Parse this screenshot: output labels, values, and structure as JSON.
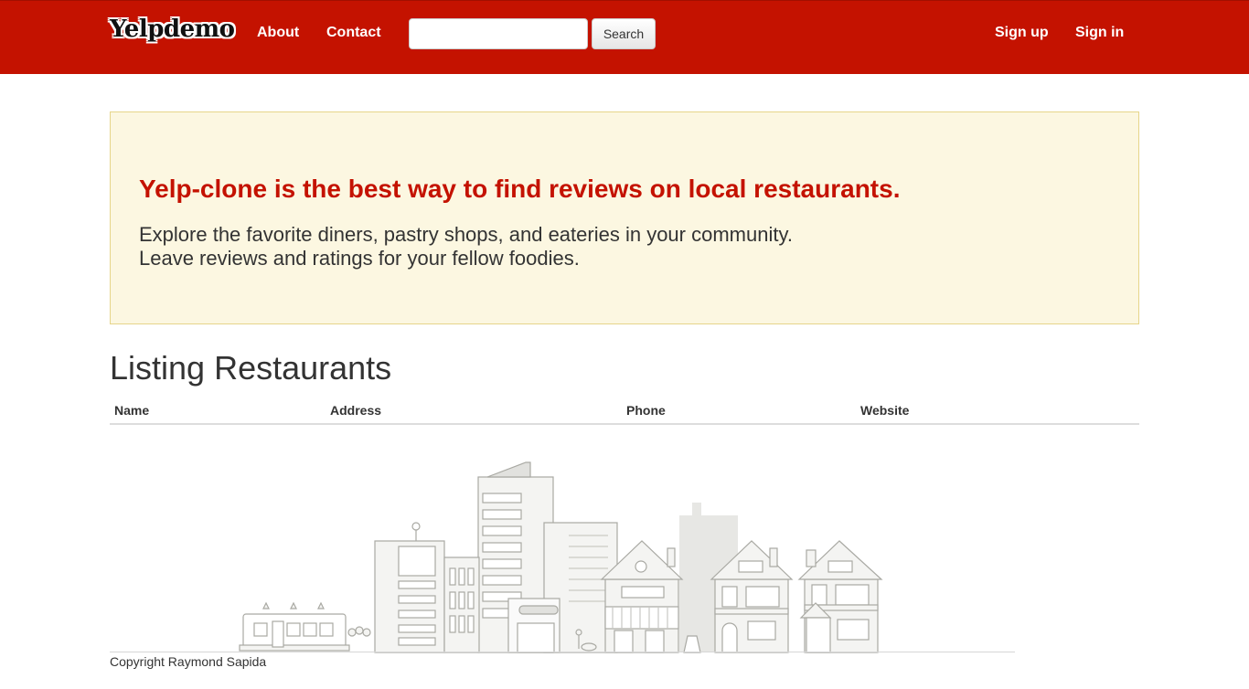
{
  "navbar": {
    "brand": "Yelpdemo",
    "links": {
      "about": "About",
      "contact": "Contact",
      "signup": "Sign up",
      "signin": "Sign in"
    },
    "search": {
      "value": "",
      "placeholder": "",
      "button": "Search"
    },
    "color": "#c41200"
  },
  "hero": {
    "title": "Yelp-clone is the best way to find reviews on local restaurants.",
    "line1": "Explore the favorite diners, pastry shops, and eateries in your community.",
    "line2": "Leave reviews and ratings for your fellow foodies."
  },
  "listing": {
    "title": "Listing Restaurants",
    "columns": [
      "Name",
      "Address",
      "Phone",
      "Website"
    ],
    "rows": []
  },
  "footer": {
    "copyright": "Copyright Raymond Sapida"
  },
  "illustration": {
    "icon": "city-skyline-illustration"
  }
}
